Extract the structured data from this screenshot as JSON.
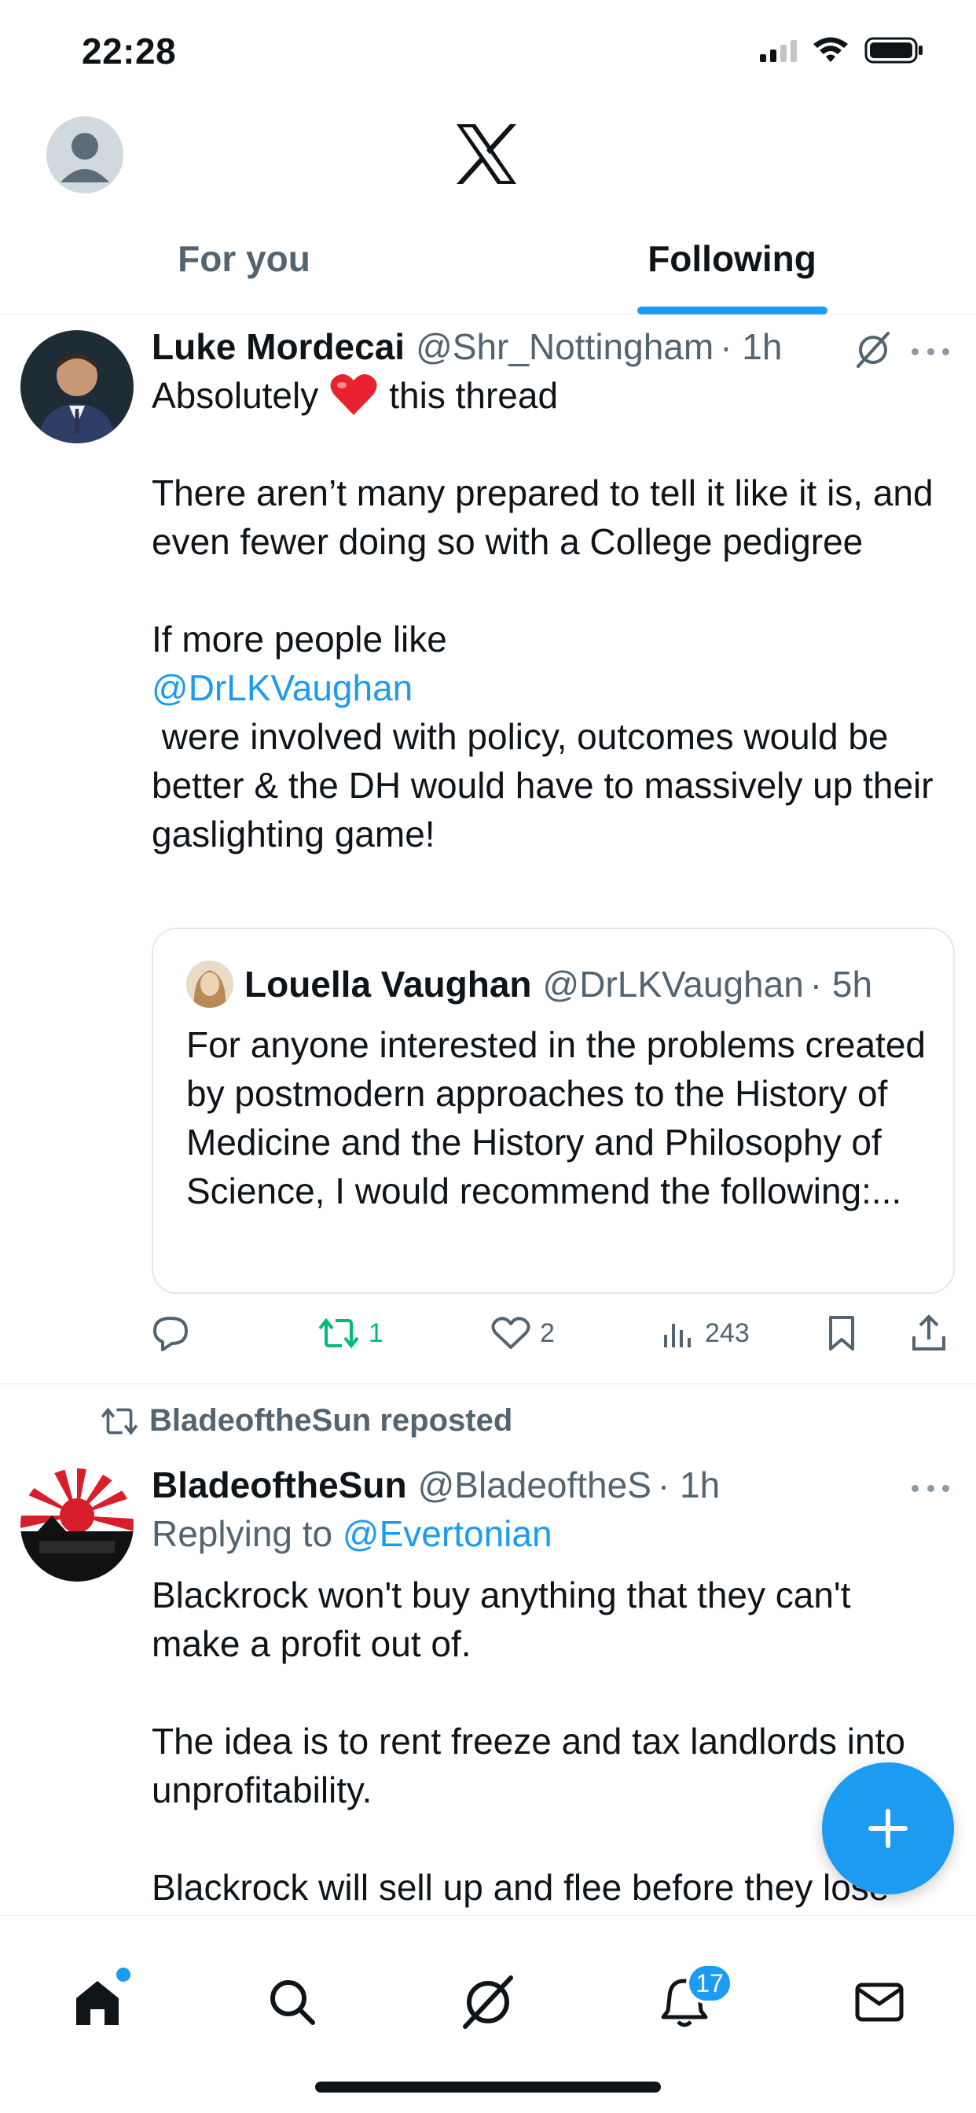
{
  "status_bar": {
    "time": "22:28"
  },
  "header": {
    "tabs": [
      {
        "label": "For you",
        "active": false
      },
      {
        "label": "Following",
        "active": true
      }
    ]
  },
  "posts": [
    {
      "author_name": "Luke Mordecai",
      "author_handle": "@Shr_Nottingham",
      "time": "· 1h",
      "text": {
        "line1_pre": "Absolutely",
        "line1_post": "this thread",
        "paragraph2": "There aren’t many prepared to tell it like it is, and even fewer doing so with a College pedigree",
        "paragraph3_pre": "If more people like",
        "mention": "@DrLKVaughan",
        "paragraph3_post": " were involved with policy, outcomes would be better & the DH would have to massively up their gaslighting game!"
      },
      "quote": {
        "author_name": "Louella Vaughan",
        "author_handle": "@DrLKVaughan",
        "time": "· 5h",
        "text": "For anyone interested in the problems created by postmodern approaches to the History of Medicine and the History and Philosophy of Science, I would recommend the following:..."
      },
      "actions": {
        "reposts": "1",
        "likes": "2",
        "views": "243"
      }
    },
    {
      "reposted_by": "BladeoftheSun reposted",
      "author_name": "BladeoftheSun",
      "author_handle": "@BladeoftheS",
      "time": "· 1h",
      "replying_prefix": "Replying to",
      "replying_to": "@Evertonian",
      "paragraph1": "Blackrock won't buy anything that they can't make a profit out of.",
      "paragraph2": "The idea is to rent freeze and tax landlords into unprofitability.",
      "paragraph3": "Blackrock will sell up and flee before they lose"
    }
  ],
  "tabbar": {
    "notifications_badge": "17"
  },
  "colors": {
    "accent": "#1d9bf0",
    "repost_green": "#00ba7c",
    "text_primary": "#0f1419",
    "text_secondary": "#536471"
  },
  "icons": [
    "avatar-icon",
    "x-logo-icon",
    "grok-icon",
    "more-icon",
    "reply-icon",
    "repost-icon",
    "like-icon",
    "views-icon",
    "bookmark-icon",
    "share-icon",
    "compose-icon",
    "home-icon",
    "search-icon",
    "notifications-icon",
    "messages-icon"
  ]
}
